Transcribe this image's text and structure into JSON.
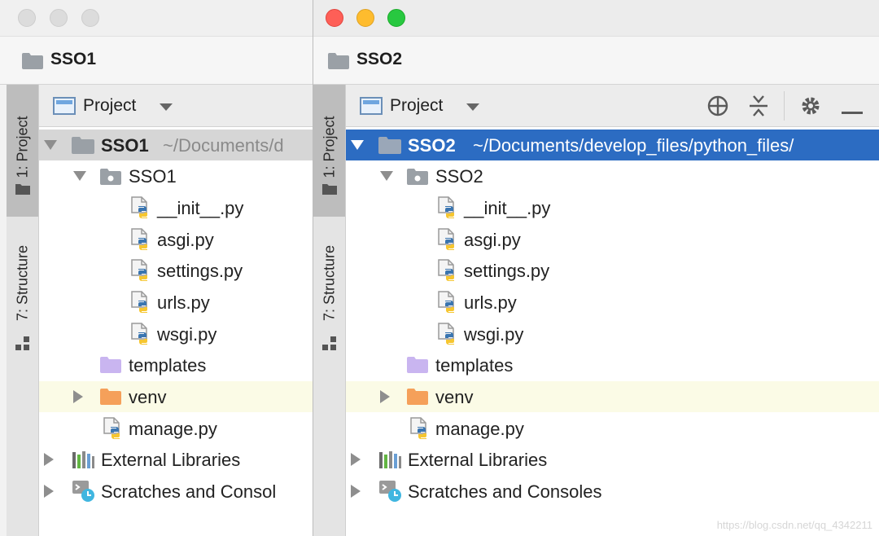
{
  "windows": [
    {
      "nav_title": "SSO1",
      "sidebar": {
        "project_tab": "1: Project",
        "structure_tab": "7: Structure"
      },
      "panel": {
        "view_label": "Project"
      },
      "tree": {
        "root": {
          "name": "SSO1",
          "path": "~/Documents/d"
        },
        "package": "SSO1",
        "files": [
          "__init__.py",
          "asgi.py",
          "settings.py",
          "urls.py",
          "wsgi.py"
        ],
        "templates": "templates",
        "venv": "venv",
        "manage": "manage.py",
        "external": "External Libraries",
        "scratches": "Scratches and Consol"
      }
    },
    {
      "nav_title": "SSO2",
      "sidebar": {
        "project_tab": "1: Project",
        "structure_tab": "7: Structure"
      },
      "panel": {
        "view_label": "Project"
      },
      "tree": {
        "root": {
          "name": "SSO2",
          "path": "~/Documents/develop_files/python_files/"
        },
        "package": "SSO2",
        "files": [
          "__init__.py",
          "asgi.py",
          "settings.py",
          "urls.py",
          "wsgi.py"
        ],
        "templates": "templates",
        "venv": "venv",
        "manage": "manage.py",
        "external": "External Libraries",
        "scratches": "Scratches and Consoles"
      }
    }
  ],
  "watermark": "https://blog.csdn.net/qq_4342211",
  "icons": {
    "folder": "folder-icon",
    "package": "package-folder-icon",
    "python": "python-file-icon",
    "templates": "templates-folder-icon",
    "venv": "excluded-folder-icon",
    "libraries": "libraries-icon",
    "scratches": "scratches-icon",
    "locate": "crosshair-icon",
    "collapse": "collapse-all-icon",
    "settings": "gear-icon",
    "hide": "minimize-icon"
  },
  "colors": {
    "selection": "#2c6cc2",
    "venv_row": "#fbfbe6",
    "venv_folder": "#f5a05a",
    "templates_folder": "#c9b5f0",
    "close": "#fe5f57",
    "minimize": "#febc2e",
    "zoom": "#28c840"
  }
}
